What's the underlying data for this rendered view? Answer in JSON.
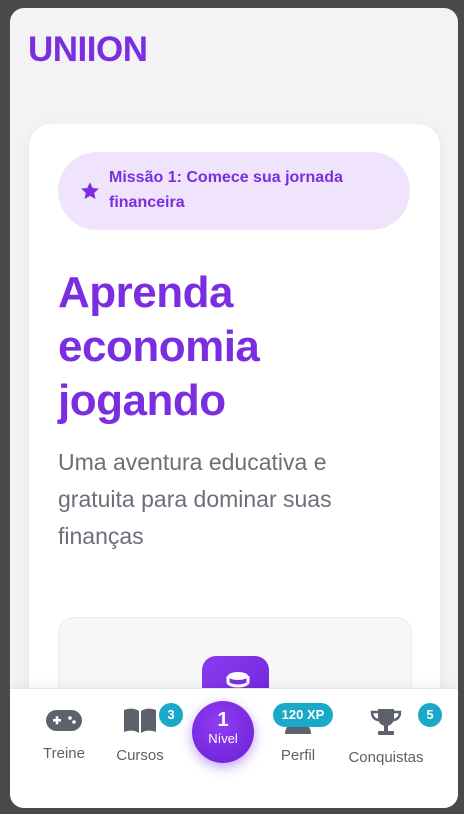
{
  "brand": {
    "name": "UNIION"
  },
  "mission": {
    "text": "Missão 1: Comece sua jornada financeira",
    "icon": "star-icon"
  },
  "hero": {
    "title": "Aprenda economia jogando",
    "subtitle": "Uma aventura educativa e gratuita para dominar suas finanças"
  },
  "colors": {
    "accent": "#7b2ee0",
    "badge": "#1aa9c9",
    "mission_bg": "#efe4fb"
  },
  "nav": {
    "items": [
      {
        "label": "Treine",
        "icon": "gamepad-icon"
      },
      {
        "label": "Cursos",
        "icon": "book-icon",
        "badge": "3"
      },
      {
        "label": "Perfil",
        "icon": "user-icon",
        "badge": "120 XP"
      },
      {
        "label": "Conquistas",
        "icon": "trophy-icon",
        "badge": "5"
      }
    ],
    "level": {
      "number": "1",
      "label": "Nível"
    }
  }
}
